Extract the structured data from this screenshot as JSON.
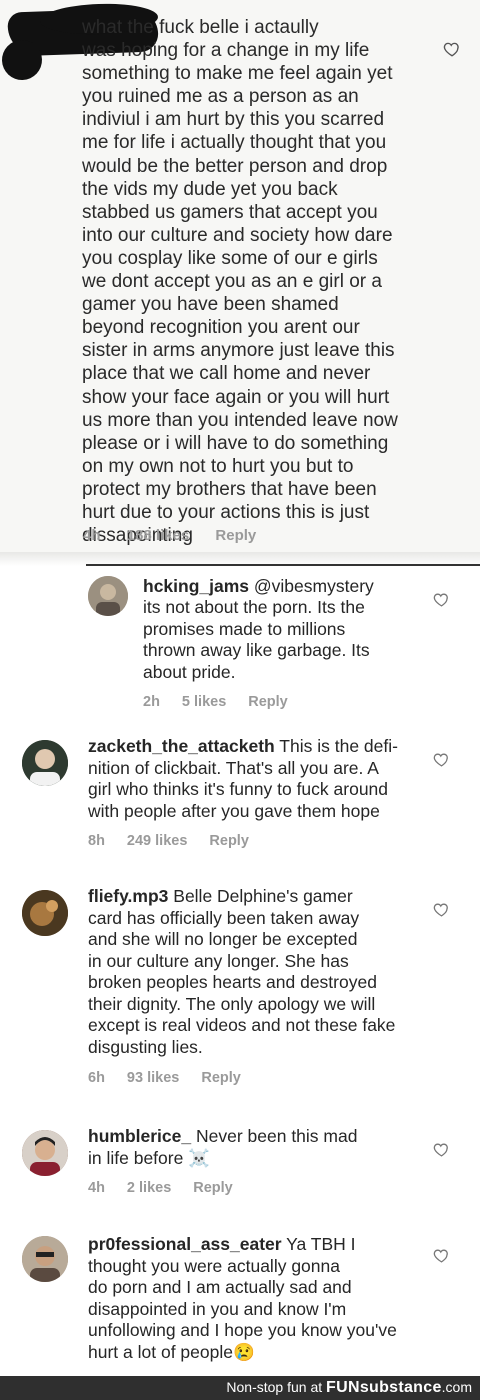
{
  "first_comment": {
    "text": "what the fuck belle i actaully\nwas hoping for a change in my life\nsomething to make me feel again yet\nyou ruined me as a person as an\nindiviul i am hurt by this you scarred\nme for life i actually thought that you\nwould be the better person and drop\nthe vids my dude yet you back\nstabbed us gamers that accept you\ninto our culture and society how dare\nyou cosplay like some of our e girls\nwe dont accept you as an e girl or a\ngamer you have been shamed\nbeyond recognition you arent our\nsister in arms anymore just leave this\nplace that we call home and never\nshow your face again or you will hurt\nus more than you intended leave now\nplease or i will have to do something\non my own not to hurt you but to\nprotect my brothers that have been\nhurt due to your actions this is just\ndissapointing",
    "time": "4h",
    "likes": "188 likes",
    "reply": "Reply"
  },
  "comments": [
    {
      "username": "hcking_jams",
      "mention": "@vibesmystery",
      "text": "its not about the porn. Its the\npromises made to millions\nthrown away like garbage. Its\nabout pride.",
      "time": "2h",
      "likes": "5 likes",
      "reply": "Reply",
      "avatar_color": "#8a8070"
    },
    {
      "username": "zacketh_the_attacketh",
      "text": "This is the defi-\nnition of clickbait. That's all you are. A\ngirl who thinks it's funny to fuck around\nwith people after you gave them hope",
      "time": "8h",
      "likes": "249 likes",
      "reply": "Reply",
      "avatar_color": "#3a4a3a"
    },
    {
      "username": "fliefy.mp3",
      "text": "Belle Delphine's gamer\ncard has officially been taken away\nand she will no longer be excepted\nin our culture any longer. She has\nbroken peoples hearts and destroyed\ntheir dignity. The only apology we will\nexcept is real videos and not these fake\ndisgusting lies.",
      "time": "6h",
      "likes": "93 likes",
      "reply": "Reply",
      "avatar_color": "#6b5030"
    },
    {
      "username": "humblerice_",
      "text": "Never been this mad\nin life before ☠️",
      "time": "4h",
      "likes": "2 likes",
      "reply": "Reply",
      "avatar_color": "#7a4a3a"
    },
    {
      "username": "pr0fessional_ass_eater",
      "text": "Ya TBH I\nthought you were actually gonna\ndo porn and I am actually sad and\ndisappointed in you and know I'm\nunfollowing and I hope you know you've\nhurt a lot of people😢",
      "time": "",
      "likes": "",
      "reply": "",
      "avatar_color": "#9a8878"
    }
  ],
  "footer": {
    "prefix": "Non-stop fun at",
    "brand": "FUNsubstance",
    "suffix": ".com"
  },
  "icons": {
    "like": "heart-outline-icon"
  },
  "colors": {
    "meta_gray": "#9a9a9a",
    "text": "#262626",
    "footer_bg": "#2f2f2f"
  }
}
